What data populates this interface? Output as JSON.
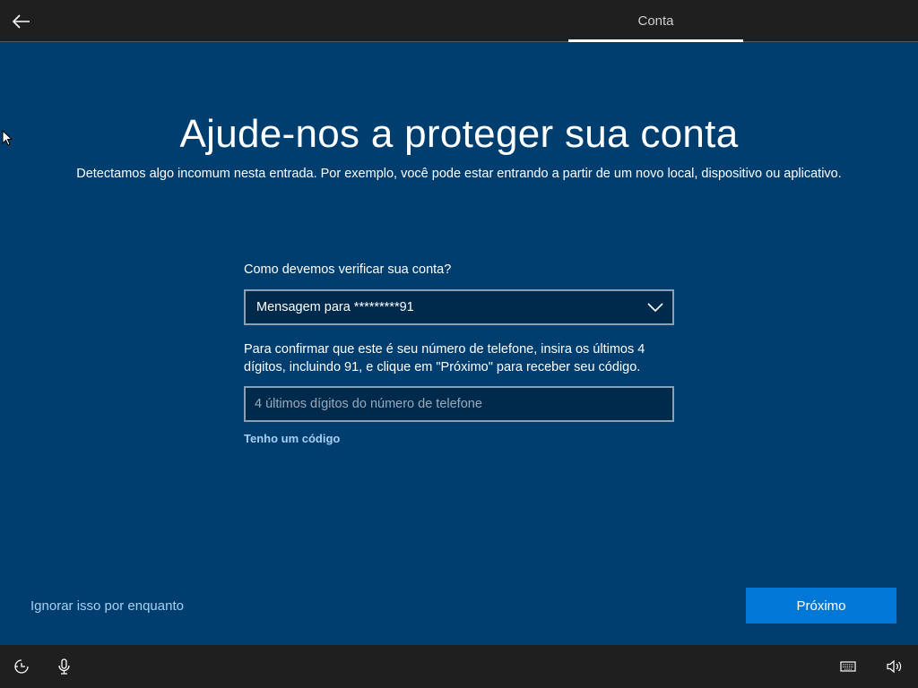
{
  "header": {
    "back_icon": "arrow-left-icon",
    "tab_label": "Conta"
  },
  "main": {
    "title": "Ajude-nos a proteger sua conta",
    "subtitle": "Detectamos algo incomum nesta entrada. Por exemplo, você pode estar entrando a partir de um novo local, dispositivo ou aplicativo.",
    "question": "Como devemos verificar sua conta?",
    "method_selected": "Mensagem para *********91",
    "instructions": "Para confirmar que este é seu número de telefone, insira os últimos 4 dígitos, incluindo 91, e clique em \"Próximo\" para receber seu código.",
    "digits_placeholder": "4 últimos dígitos do número de telefone",
    "digits_value": "",
    "have_code_link": "Tenho um código"
  },
  "footer": {
    "skip_link": "Ignorar isso por enquanto",
    "next_button": "Próximo"
  },
  "taskbar": {
    "icons": [
      "ease-of-access-icon",
      "microphone-icon",
      "keyboard-icon",
      "volume-icon"
    ]
  },
  "colors": {
    "background": "#003e6f",
    "bar": "#1f1f1f",
    "accent": "#0078d7",
    "link": "#a8d0f5"
  }
}
